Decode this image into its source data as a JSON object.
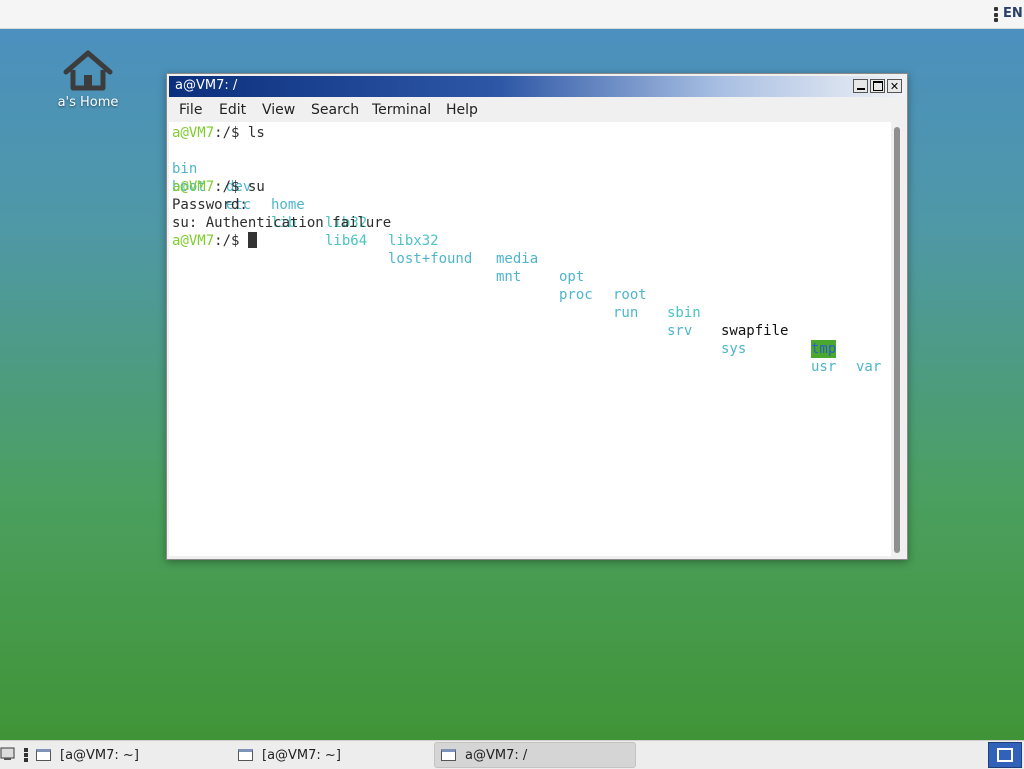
{
  "top_panel": {
    "language": "EN"
  },
  "desktop": {
    "home_icon_label": "a's Home"
  },
  "window": {
    "title": "a@VM7: /",
    "menu": [
      "File",
      "Edit",
      "View",
      "Search",
      "Terminal",
      "Help"
    ]
  },
  "terminal": {
    "prompt_user": "a@VM7",
    "prompt_path": ":/$",
    "cmd1": "ls",
    "ls_row1": [
      "bin",
      "dev",
      "home",
      "lib32",
      "libx32",
      "media",
      "opt",
      "root",
      "sbin",
      "swapfile",
      "tmp",
      "var"
    ],
    "ls_row2": [
      "boot",
      "etc",
      "lib",
      "lib64",
      "lost+found",
      "mnt",
      "proc",
      "run",
      "srv",
      "sys",
      "usr"
    ],
    "cmd2": "su",
    "password_line": "Password:",
    "error_line": "su: Authentication failure"
  },
  "taskbar": {
    "tasks": [
      "[a@VM7: ~]",
      "[a@VM7: ~]",
      "a@VM7: /"
    ]
  }
}
